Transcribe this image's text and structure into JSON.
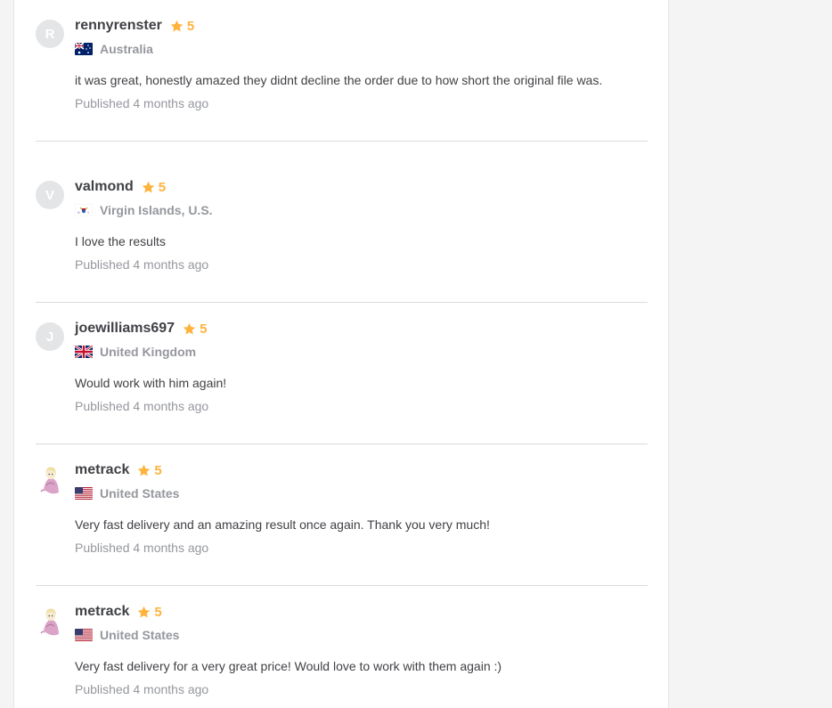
{
  "colors": {
    "star": "#ffb33e",
    "username": "#404145",
    "muted": "#95979d",
    "divider": "#dadbdd"
  },
  "reviews": [
    {
      "initial": "R",
      "username": "rennyrenster",
      "rating": "5",
      "country": "Australia",
      "flag": "australia-flag-icon",
      "text": "it was great, honestly amazed they didnt decline the order due to how short the original file was.",
      "published": "Published 4 months ago"
    },
    {
      "initial": "V",
      "username": "valmond",
      "rating": "5",
      "country": "Virgin Islands, U.S.",
      "flag": "us-virgin-islands-flag-icon",
      "text": "I love the results",
      "published": "Published 4 months ago"
    },
    {
      "initial": "J",
      "username": "joewilliams697",
      "rating": "5",
      "country": "United Kingdom",
      "flag": "uk-flag-icon",
      "text": "Would work with him again!",
      "published": "Published 4 months ago"
    },
    {
      "initial": "",
      "username": "metrack",
      "rating": "5",
      "country": "United States",
      "flag": "us-flag-icon",
      "text": "Very fast delivery and an amazing result once again. Thank you very much!",
      "published": "Published 4 months ago"
    },
    {
      "initial": "",
      "username": "metrack",
      "rating": "5",
      "country": "United States",
      "flag": "us-flag-icon",
      "text": "Very fast delivery for a very great price! Would love to work with them again :)",
      "published": "Published 4 months ago"
    }
  ]
}
